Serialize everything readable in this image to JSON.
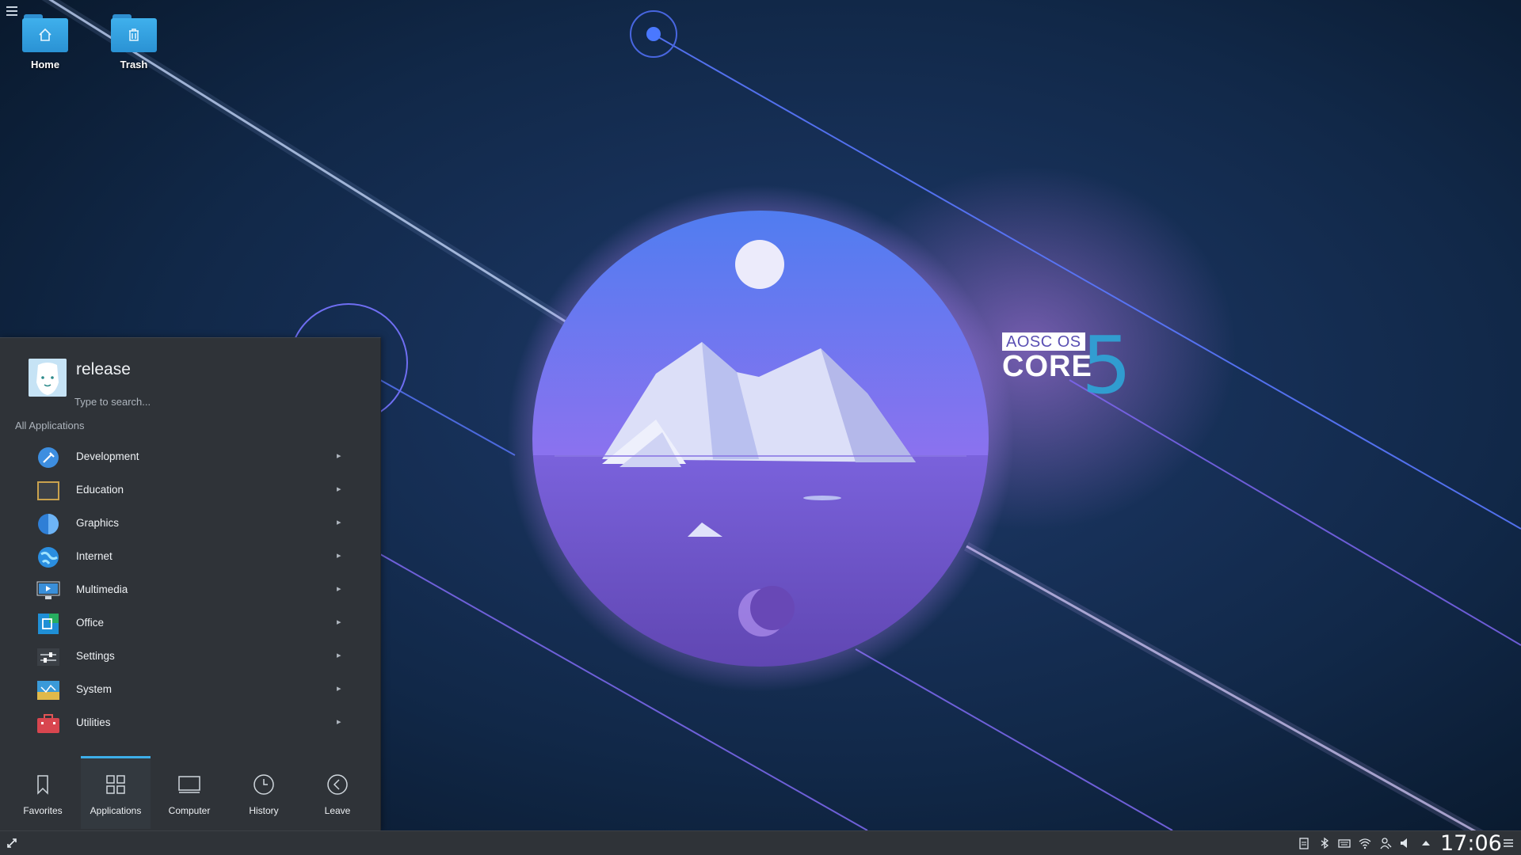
{
  "desktop": {
    "icons": [
      {
        "label": "Home"
      },
      {
        "label": "Trash"
      }
    ]
  },
  "brand": {
    "tag": "AOSC OS",
    "core": "CORE",
    "version": "5"
  },
  "launcher": {
    "user_name": "release",
    "search_placeholder": "Type to search...",
    "section_title": "All Applications",
    "categories": [
      {
        "label": "Development",
        "icon": "development-icon"
      },
      {
        "label": "Education",
        "icon": "education-icon"
      },
      {
        "label": "Graphics",
        "icon": "graphics-icon"
      },
      {
        "label": "Internet",
        "icon": "internet-icon"
      },
      {
        "label": "Multimedia",
        "icon": "multimedia-icon"
      },
      {
        "label": "Office",
        "icon": "office-icon"
      },
      {
        "label": "Settings",
        "icon": "settings-icon"
      },
      {
        "label": "System",
        "icon": "system-icon"
      },
      {
        "label": "Utilities",
        "icon": "utilities-icon"
      }
    ],
    "tabs": [
      {
        "label": "Favorites",
        "icon": "bookmark-icon"
      },
      {
        "label": "Applications",
        "icon": "grid-icon",
        "active": true
      },
      {
        "label": "Computer",
        "icon": "computer-icon"
      },
      {
        "label": "History",
        "icon": "clock-icon"
      },
      {
        "label": "Leave",
        "icon": "back-icon"
      }
    ]
  },
  "taskbar": {
    "clock": "17:06",
    "tray_icons": [
      "clipboard-icon",
      "bluetooth-icon",
      "keyboard-icon",
      "wifi-icon",
      "user-icon",
      "volume-icon",
      "arrow-up-icon",
      "menu-icon"
    ]
  },
  "colors": {
    "accent": "#3daee9",
    "panel": "#2f3338",
    "wallpaper_bg": "#0a1a30"
  }
}
